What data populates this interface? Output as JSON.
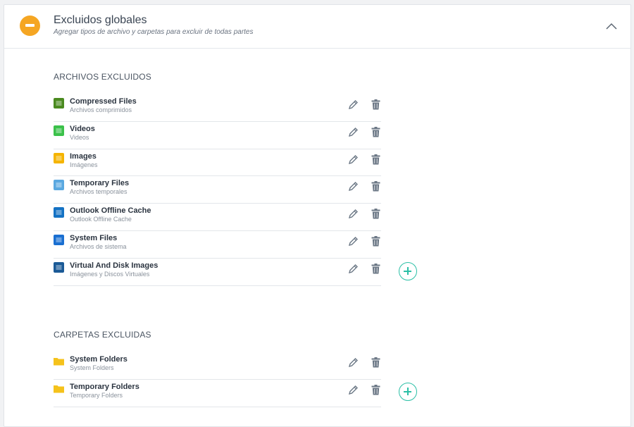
{
  "header": {
    "title": "Excluidos globales",
    "subtitle": "Agregar tipos de archivo y carpetas para excluir de todas partes",
    "icon": "minus-circle-icon",
    "accent_color": "#f5a623"
  },
  "files_section": {
    "title": "ARCHIVOS EXCLUIDOS",
    "items": [
      {
        "name": "Compressed Files",
        "desc": "Archivos comprimidos",
        "icon": "zip-file-icon",
        "color": "#4a8a1f"
      },
      {
        "name": "Videos",
        "desc": "Videos",
        "icon": "video-file-icon",
        "color": "#3bc14a"
      },
      {
        "name": "Images",
        "desc": "Imágenes",
        "icon": "image-file-icon",
        "color": "#f5b400"
      },
      {
        "name": "Temporary Files",
        "desc": "Archivos temporales",
        "icon": "tmp-file-icon",
        "color": "#5aa8e0"
      },
      {
        "name": "Outlook Offline Cache",
        "desc": "Outlook Offline Cache",
        "icon": "outlook-icon",
        "color": "#1472c4"
      },
      {
        "name": "System Files",
        "desc": "Archivos de sistema",
        "icon": "system-file-icon",
        "color": "#1a6fd1"
      },
      {
        "name": "Virtual And Disk Images",
        "desc": "Imágenes y Discos Virtuales",
        "icon": "iso-file-icon",
        "color": "#1b5a96"
      }
    ]
  },
  "folders_section": {
    "title": "CARPETAS EXCLUIDAS",
    "items": [
      {
        "name": "System Folders",
        "desc": "System Folders",
        "icon": "system-folder-icon",
        "color": "#f5c21b"
      },
      {
        "name": "Temporary Folders",
        "desc": "Temporary Folders",
        "icon": "folder-icon",
        "color": "#f5c21b"
      }
    ]
  },
  "colors": {
    "add_button": "#2bbfa6",
    "action_icons": "#6b7785"
  }
}
